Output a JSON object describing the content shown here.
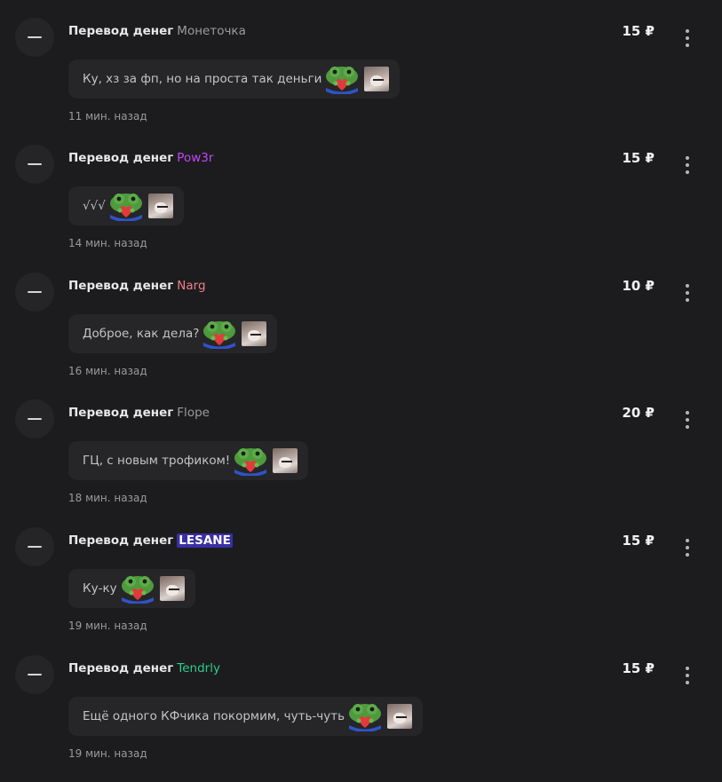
{
  "transfers": [
    {
      "kind": "Перевод денег",
      "user": "Монеточка",
      "user_color": "#9c9c9c",
      "amount": "15 ₽",
      "message": "Ку, хз за фп, но на проста так деньги",
      "time": "11 мин. назад"
    },
    {
      "kind": "Перевод денег",
      "user": "Pow3r",
      "user_color": "#c146f5",
      "amount": "15 ₽",
      "message": "√√√",
      "time": "14 мин. назад"
    },
    {
      "kind": "Перевод денег",
      "user": "Narg",
      "user_color": "#ee7f8a",
      "amount": "10 ₽",
      "message": "Доброе, как дела?",
      "time": "16 мин. назад"
    },
    {
      "kind": "Перевод денег",
      "user": "Flope",
      "user_color": "#9a9a9a",
      "amount": "20 ₽",
      "message": "ГЦ, с новым трофиком!",
      "time": "18 мин. назад"
    },
    {
      "kind": "Перевод денег",
      "user": "LESANE",
      "user_color": "#ffffff",
      "user_bg": "#3a2fa3",
      "amount": "15 ₽",
      "message": "Ку-ку",
      "time": "19 мин. назад"
    },
    {
      "kind": "Перевод денег",
      "user": "Tendrly",
      "user_color": "#2ecc8a",
      "amount": "15 ₽",
      "message": "Ещё одного КФчика покормим, чуть-чуть",
      "time": "19 мин. назад"
    }
  ],
  "icons": {
    "avatar": "minus-icon",
    "menu": "more-vertical-icon",
    "emoji_1": "frog-heart-emoji",
    "emoji_2": "cat-emoji"
  }
}
